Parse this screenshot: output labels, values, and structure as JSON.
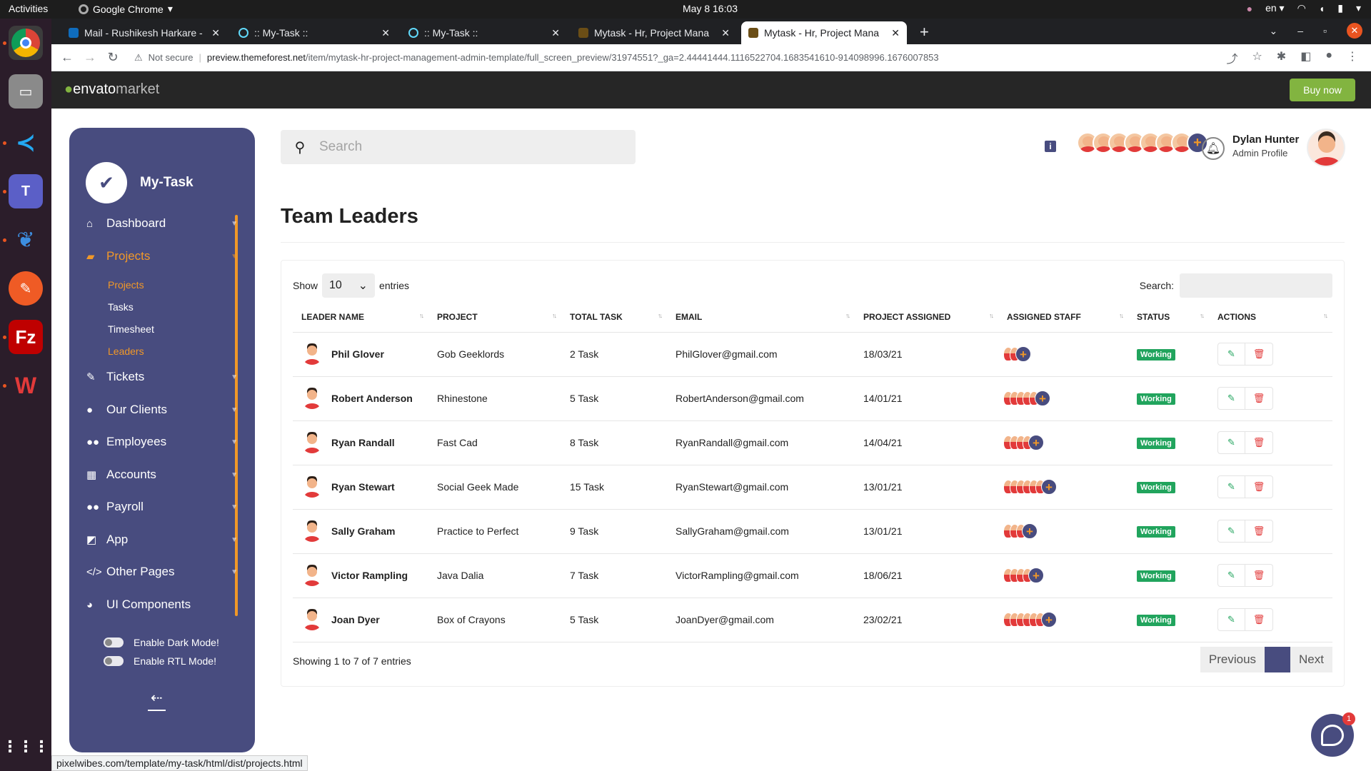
{
  "os": {
    "activities": "Activities",
    "app_name": "Google Chrome",
    "clock": "May 8  16:03",
    "lang": "en"
  },
  "browser": {
    "tabs": [
      {
        "title": "Mail - Rushikesh Harkare -",
        "color": "#0f6cbd"
      },
      {
        "title": ":: My-Task ::",
        "color": "#61dafb"
      },
      {
        "title": ":: My-Task ::",
        "color": "#61dafb"
      },
      {
        "title": "Mytask - Hr, Project Mana",
        "color": "#6b4e16"
      },
      {
        "title": "Mytask - Hr, Project Mana",
        "color": "#6b4e16"
      }
    ],
    "security": "Not secure",
    "url_host": "preview.themeforest.net",
    "url_path": "/item/mytask-hr-project-management-admin-template/full_screen_preview/31974551?_ga=2.44441444.1116522704.1683541610-914098996.1676007853"
  },
  "envato": {
    "logo_a": "envato",
    "logo_b": "market",
    "buy": "Buy now"
  },
  "sidebar": {
    "brand": "My-Task",
    "items": [
      {
        "label": "Dashboard",
        "icon": "home-icon"
      },
      {
        "label": "Projects",
        "icon": "briefcase-icon"
      },
      {
        "label": "Tickets",
        "icon": "ticket-icon"
      },
      {
        "label": "Our Clients",
        "icon": "user-icon"
      },
      {
        "label": "Employees",
        "icon": "users-icon"
      },
      {
        "label": "Accounts",
        "icon": "calculator-icon"
      },
      {
        "label": "Payroll",
        "icon": "users-icon"
      },
      {
        "label": "App",
        "icon": "app-icon"
      },
      {
        "label": "Other Pages",
        "icon": "code-icon"
      },
      {
        "label": "UI Components",
        "icon": "palette-icon"
      }
    ],
    "sub_items": [
      "Projects",
      "Tasks",
      "Timesheet",
      "Leaders"
    ],
    "dark_mode": "Enable Dark Mode!",
    "rtl_mode": "Enable RTL Mode!"
  },
  "header": {
    "search_placeholder": "Search",
    "user_name": "Dylan Hunter",
    "user_role": "Admin Profile"
  },
  "page": {
    "title": "Team Leaders"
  },
  "table": {
    "show_label": "Show",
    "entries_label": "entries",
    "page_size": "10",
    "search_label": "Search:",
    "columns": [
      "LEADER NAME",
      "PROJECT",
      "TOTAL TASK",
      "EMAIL",
      "PROJECT ASSIGNED",
      "ASSIGNED STAFF",
      "STATUS",
      "ACTIONS"
    ],
    "rows": [
      {
        "name": "Phil Glover",
        "project": "Gob Geeklords",
        "tasks": "2 Task",
        "email": "PhilGlover@gmail.com",
        "assigned": "18/03/21",
        "staff": 2,
        "status": "Working"
      },
      {
        "name": "Robert Anderson",
        "project": "Rhinestone",
        "tasks": "5 Task",
        "email": "RobertAnderson@gmail.com",
        "assigned": "14/01/21",
        "staff": 5,
        "status": "Working"
      },
      {
        "name": "Ryan Randall",
        "project": "Fast Cad",
        "tasks": "8 Task",
        "email": "RyanRandall@gmail.com",
        "assigned": "14/04/21",
        "staff": 4,
        "status": "Working"
      },
      {
        "name": "Ryan Stewart",
        "project": "Social Geek Made",
        "tasks": "15 Task",
        "email": "RyanStewart@gmail.com",
        "assigned": "13/01/21",
        "staff": 6,
        "status": "Working"
      },
      {
        "name": "Sally Graham",
        "project": "Practice to Perfect",
        "tasks": "9 Task",
        "email": "SallyGraham@gmail.com",
        "assigned": "13/01/21",
        "staff": 3,
        "status": "Working"
      },
      {
        "name": "Victor Rampling",
        "project": "Java Dalia",
        "tasks": "7 Task",
        "email": "VictorRampling@gmail.com",
        "assigned": "18/06/21",
        "staff": 4,
        "status": "Working"
      },
      {
        "name": "Joan Dyer",
        "project": "Box of Crayons",
        "tasks": "5 Task",
        "email": "JoanDyer@gmail.com",
        "assigned": "23/02/21",
        "staff": 6,
        "status": "Working"
      }
    ],
    "info": "Showing 1 to 7 of 7 entries",
    "prev": "Previous",
    "next": "Next"
  },
  "status_url": "pixelwibes.com/template/my-task/html/dist/projects.html",
  "chat_count": "1",
  "colors": {
    "sidebar": "#484c7f",
    "accent": "#f19828",
    "success": "#21a45d",
    "danger": "#e23a3a"
  }
}
